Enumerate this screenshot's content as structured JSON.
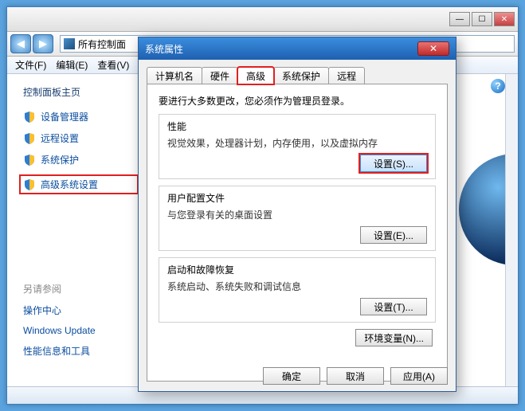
{
  "bg": {
    "winbtns": {
      "min": "—",
      "max": "☐",
      "close": "✕"
    },
    "navback": "◀",
    "navfwd": "▶",
    "addr_text": "所有控制面",
    "menu": {
      "file": "文件(F)",
      "edit": "编辑(E)",
      "view": "查看(V)"
    },
    "help_q": "?"
  },
  "sidebar": {
    "home": "控制面板主页",
    "items": [
      {
        "label": "设备管理器"
      },
      {
        "label": "远程设置"
      },
      {
        "label": "系统保护"
      },
      {
        "label": "高级系统设置"
      }
    ],
    "seealso_head": "另请参阅",
    "seealso": [
      {
        "label": "操作中心"
      },
      {
        "label": "Windows Update"
      },
      {
        "label": "性能信息和工具"
      }
    ]
  },
  "dlg": {
    "title": "系统属性",
    "close_x": "✕",
    "tabs": {
      "computer": "计算机名",
      "hardware": "硬件",
      "advanced": "高级",
      "protection": "系统保护",
      "remote": "远程"
    },
    "note": "要进行大多数更改，您必须作为管理员登录。",
    "perf": {
      "title": "性能",
      "desc": "视觉效果，处理器计划，内存使用，以及虚拟内存",
      "btn": "设置(S)..."
    },
    "profile": {
      "title": "用户配置文件",
      "desc": "与您登录有关的桌面设置",
      "btn": "设置(E)..."
    },
    "startup": {
      "title": "启动和故障恢复",
      "desc": "系统启动、系统失败和调试信息",
      "btn": "设置(T)..."
    },
    "env_btn": "环境变量(N)...",
    "ok": "确定",
    "cancel": "取消",
    "apply": "应用(A)"
  }
}
